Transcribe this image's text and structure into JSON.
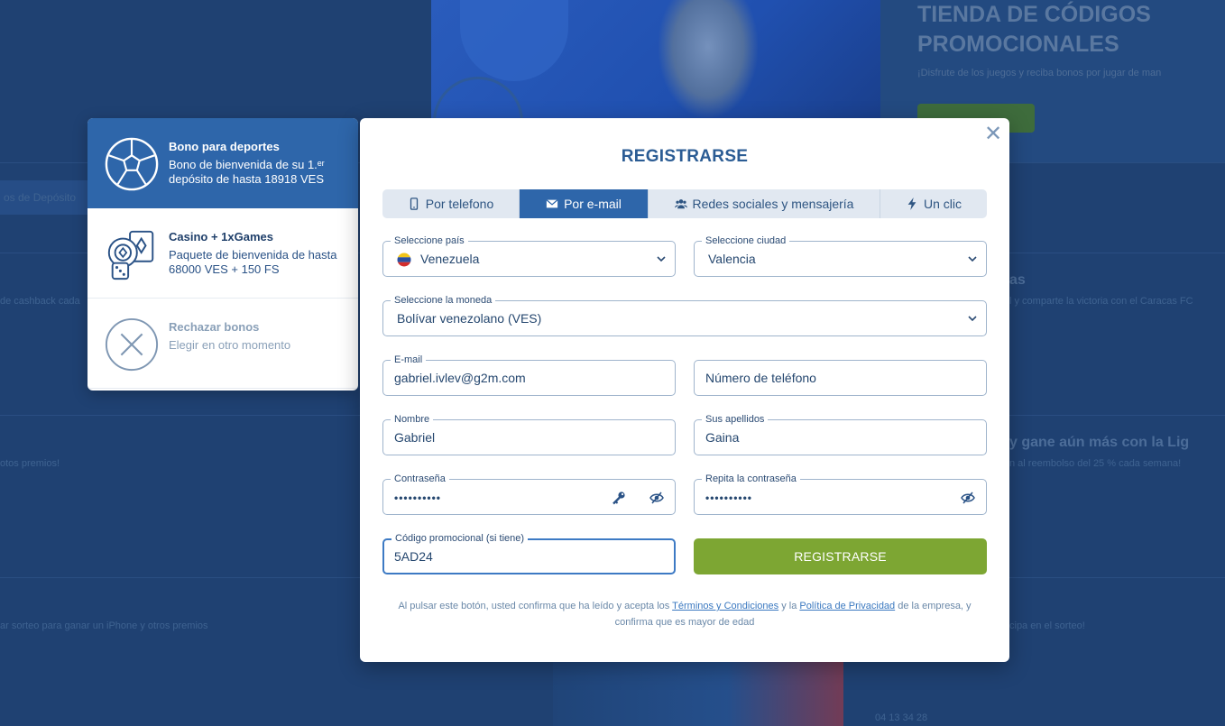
{
  "background": {
    "promo_title": "TIENDA DE CÓDIGOS PROMOCIONALES",
    "promo_subtitle": "¡Disfrute de los juegos y reciba bonos por jugar de man",
    "tab_label": "os de Depósito",
    "row_texts": [
      "de cashback cada",
      "otos premios!",
      "ar sorteo para ganar un iPhone y otros premios"
    ],
    "right_texts": [
      "as",
      "l y comparte la victoria con el Caracas FC",
      "y gane aún más con la Lig",
      "n al reembolso del 25 % cada semana!",
      "cipa en el sorteo!",
      "04 13 34 28"
    ]
  },
  "bonus_panel": {
    "items": [
      {
        "title": "Bono para deportes",
        "description": "Bono de bienvenida de su 1.ᵉʳ depósito de hasta 18918 VES",
        "icon": "soccer-ball-icon"
      },
      {
        "title": "Casino + 1xGames",
        "description": "Paquete de bienvenida de hasta 68000 VES + 150 FS",
        "icon": "casino-chips-icon"
      },
      {
        "title": "Rechazar bonos",
        "description": "Elegir en otro momento",
        "icon": "reject-icon"
      }
    ]
  },
  "modal": {
    "title": "REGISTRARSE",
    "close_icon": "close-icon",
    "tabs": [
      {
        "label": "Por telefono",
        "icon": "phone-icon"
      },
      {
        "label": "Por e-mail",
        "icon": "envelope-icon",
        "active": true
      },
      {
        "label": "Redes sociales y mensajería",
        "icon": "users-icon"
      },
      {
        "label": "Un clic",
        "icon": "lightning-icon"
      }
    ],
    "fields": {
      "country": {
        "label": "Seleccione país",
        "value": "Venezuela"
      },
      "city": {
        "label": "Seleccione ciudad",
        "value": "Valencia"
      },
      "currency": {
        "label": "Seleccione la moneda",
        "value": "Bolívar venezolano (VES)"
      },
      "email": {
        "label": "E-mail",
        "value": "gabriel.ivlev@g2m.com"
      },
      "phone": {
        "placeholder": "Número de teléfono"
      },
      "first_name": {
        "label": "Nombre",
        "value": "Gabriel"
      },
      "last_name": {
        "label": "Sus apellidos",
        "value": "Gaina"
      },
      "password": {
        "label": "Contraseña",
        "value": "••••••••••"
      },
      "password_repeat": {
        "label": "Repita la contraseña",
        "value": "••••••••••"
      },
      "promo_code": {
        "label": "Código promocional (si tiene)",
        "value": "5AD24"
      }
    },
    "submit_label": "REGISTRARSE",
    "legal": {
      "prefix": "Al pulsar este botón, usted confirma que ha leído y acepta los ",
      "terms_link": "Términos y Condiciones",
      "middle": " y la ",
      "privacy_link": "Política de Privacidad",
      "suffix": " de la empresa, y confirma que es mayor de edad"
    }
  },
  "colors": {
    "accent": "#2e66aa",
    "submit": "#7da633",
    "overlay": "#1f4172"
  }
}
